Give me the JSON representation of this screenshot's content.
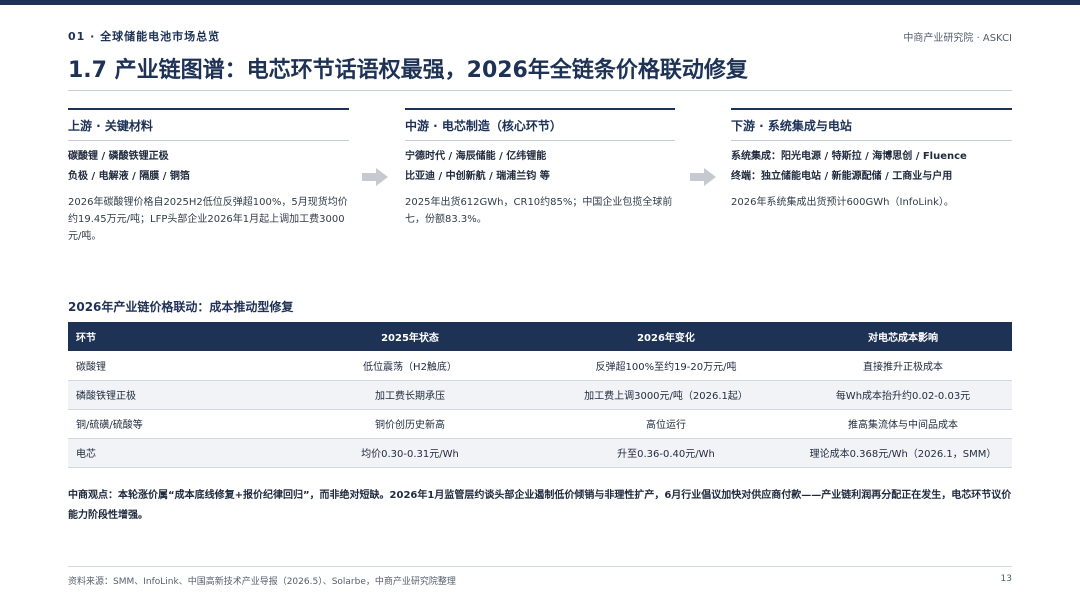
{
  "header": {
    "section_label": "01 · 全球储能电池市场总览",
    "brand": "中商产业研究院 · ASKCI",
    "title": "1.7 产业链图谱：电芯环节话语权最强，2026年全链条价格联动修复"
  },
  "chain": {
    "upstream": {
      "title": "上游 · 关键材料",
      "lines": [
        "碳酸锂 / 磷酸铁锂正极",
        "负极 / 电解液 / 隔膜 / 铜箔"
      ],
      "note": "2026年碳酸锂价格自2025H2低位反弹超100%，5月现货均价约19.45万元/吨；LFP头部企业2026年1月起上调加工费3000元/吨。"
    },
    "midstream": {
      "title": "中游 · 电芯制造（核心环节）",
      "lines": [
        "宁德时代 / 海辰储能 / 亿纬锂能",
        "比亚迪 / 中创新航 / 瑞浦兰钧 等"
      ],
      "note": "2025年出货612GWh，CR10约85%；中国企业包揽全球前七，份额83.3%。"
    },
    "downstream": {
      "title": "下游 · 系统集成与电站",
      "lines": [
        "系统集成：阳光电源 / 特斯拉 / 海博思创 / Fluence",
        "终端：独立储能电站 / 新能源配储 / 工商业与户用"
      ],
      "note": "2026年系统集成出货预计600GWh（InfoLink）。"
    },
    "arrow_icon": "right-arrow-icon"
  },
  "table": {
    "title": "2026年产业链价格联动：成本推动型修复",
    "headers": [
      "环节",
      "2025年状态",
      "2026年变化",
      "对电芯成本影响"
    ],
    "rows": [
      [
        "碳酸锂",
        "低位震荡（H2触底）",
        "反弹超100%至约19-20万元/吨",
        "直接推升正极成本"
      ],
      [
        "磷酸铁锂正极",
        "加工费长期承压",
        "加工费上调3000元/吨（2026.1起）",
        "每Wh成本抬升约0.02-0.03元"
      ],
      [
        "铜/硫磺/硫酸等",
        "铜价创历史新高",
        "高位运行",
        "推高集流体与中间品成本"
      ],
      [
        "电芯",
        "均价0.30-0.31元/Wh",
        "升至0.36-0.40元/Wh",
        "理论成本0.368元/Wh（2026.1，SMM）"
      ]
    ]
  },
  "viewpoint": "中商观点：本轮涨价属“成本底线修复+报价纪律回归”，而非绝对短缺。2026年1月监管层约谈头部企业遏制低价倾销与非理性扩产，6月行业倡议加快对供应商付款——产业链利润再分配正在发生，电芯环节议价能力阶段性增强。",
  "footer": {
    "source": "资料来源：SMM、InfoLink、中国高新技术产业导报（2026.5）、Solarbe，中商产业研究院整理",
    "page_number": "13"
  },
  "colors": {
    "primary": "#1e3256",
    "arrow": "#c6c9cf",
    "row_alt": "#f1f3f6"
  }
}
